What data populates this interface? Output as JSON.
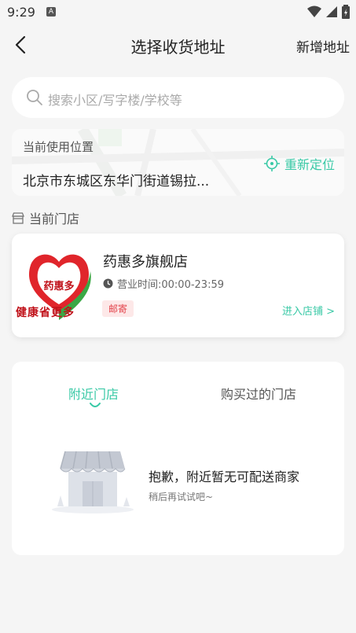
{
  "status_bar": {
    "time": "9:29",
    "app_icon": "A"
  },
  "nav": {
    "title": "选择收货地址",
    "add_label": "新增地址"
  },
  "search": {
    "placeholder": "搜索小区/写字楼/学校等"
  },
  "location": {
    "label": "当前使用位置",
    "address": "北京市东城区东华门街道锡拉...",
    "relocate_label": "重新定位"
  },
  "current_store": {
    "section_label": "当前门店",
    "logo_text": "药惠多",
    "logo_slogan": "健康省更多",
    "name": "药惠多旗舰店",
    "hours": "营业时间:00:00-23:59",
    "tag": "邮寄",
    "enter_label": "进入店铺 >"
  },
  "tabs": [
    {
      "label": "附近门店",
      "active": true
    },
    {
      "label": "购买过的门店",
      "active": false
    }
  ],
  "empty_state": {
    "title": "抱歉，附近暂无可配送商家",
    "subtitle": "稍后再试试吧~"
  },
  "colors": {
    "accent": "#39c9a6",
    "tag": "#e3424a",
    "logo_red": "#c0121a",
    "logo_green": "#3aa845"
  }
}
